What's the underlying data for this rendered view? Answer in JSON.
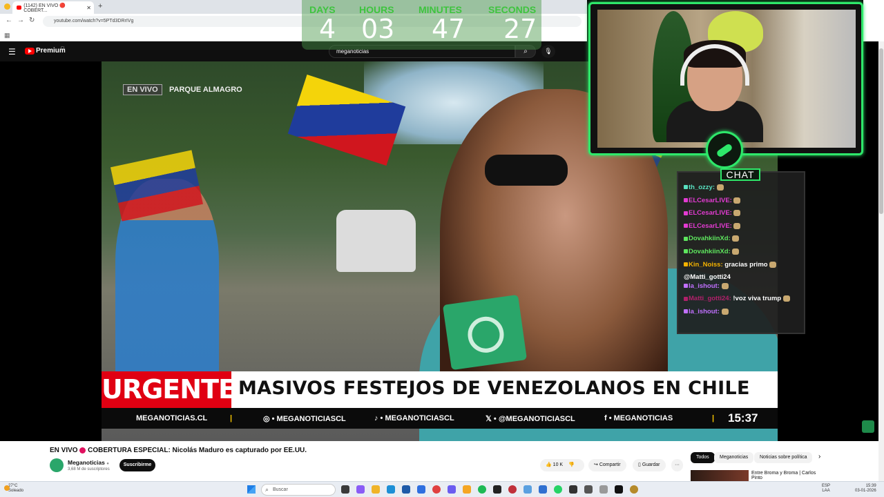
{
  "browser": {
    "tab_title": "(1142) EN VIVO 🔴 COBERT...",
    "url": "youtube.com/watch?v=5PTd3DRrIVg",
    "new_tab_label": "+",
    "side_note": "favoritos"
  },
  "youtube": {
    "logo_text": "Premium",
    "logo_region": "CL",
    "search_query": "meganoticias"
  },
  "countdown": {
    "days_label": "DAYS",
    "hours_label": "HOURS",
    "minutes_label": "MINUTES",
    "seconds_label": "SECONDS",
    "days": "4",
    "hours": "03",
    "minutes": "47",
    "seconds": "27"
  },
  "video": {
    "live_tag": "EN VIVO",
    "location": "PARQUE ALMAGRO",
    "urgent_label": "URGENTE",
    "headline": "MASIVOS FESTEJOS DE VENEZOLANOS EN CHILE",
    "ticker": {
      "site": "MEGANOTICIAS.CL",
      "instagram": "◎ • MEGANOTICIASCL",
      "tiktok": "♪ • MEGANOTICIASCL",
      "x": "𝕏 • @MEGANOTICIASCL",
      "facebook": "f • MEGANOTICIAS",
      "time": "15:37"
    }
  },
  "chat": {
    "title": "CHAT",
    "messages": [
      {
        "user": "th_ozzy:",
        "text": "",
        "color": "#58e0c0"
      },
      {
        "user": "ELCesarLIVE:",
        "text": "",
        "color": "#e23bd1"
      },
      {
        "user": "ELCesarLIVE:",
        "text": "",
        "color": "#e23bd1"
      },
      {
        "user": "ELCesarLIVE:",
        "text": "",
        "color": "#e23bd1"
      },
      {
        "user": "DovahkiinXd:",
        "text": "",
        "color": "#5ee65e"
      },
      {
        "user": "DovahkiinXd:",
        "text": "",
        "color": "#5ee65e"
      },
      {
        "user": "Kin_Noiss:",
        "text": "gracias primo",
        "color": "#f5b300"
      },
      {
        "user": "",
        "text": "@Matti_gotti24",
        "color": "#ffffff"
      },
      {
        "user": "la_ishout:",
        "text": "",
        "color": "#c070ff"
      },
      {
        "user": "Matti_gotti24:",
        "text": "!voz viva trump",
        "color": "#b0206a"
      },
      {
        "user": "la_ishout:",
        "text": "",
        "color": "#c070ff"
      }
    ]
  },
  "below": {
    "title_prefix": "EN VIVO",
    "title_suffix": "COBERTURA ESPECIAL: Nicolás Maduro es capturado por EE.UU.",
    "channel": "Meganoticias",
    "verified": "●",
    "subscribers": "3,68 M de suscriptores",
    "subscribe_label": "Suscribirme",
    "likes": "10 K",
    "share_label": "Compartir",
    "save_label": "Guardar",
    "more_label": "···",
    "chips": [
      "Todos",
      "Meganoticias",
      "Noticias sobre política"
    ],
    "chip_next": "›",
    "rec_title": "Entre Broma y Broma | Carlos Pinto"
  },
  "taskbar": {
    "temperature": "27°C",
    "weather": "Soleado",
    "search_placeholder": "Buscar",
    "lang": "ESP",
    "lang_sub": "LAA",
    "time": "15:39",
    "date": "03-01-2026"
  }
}
